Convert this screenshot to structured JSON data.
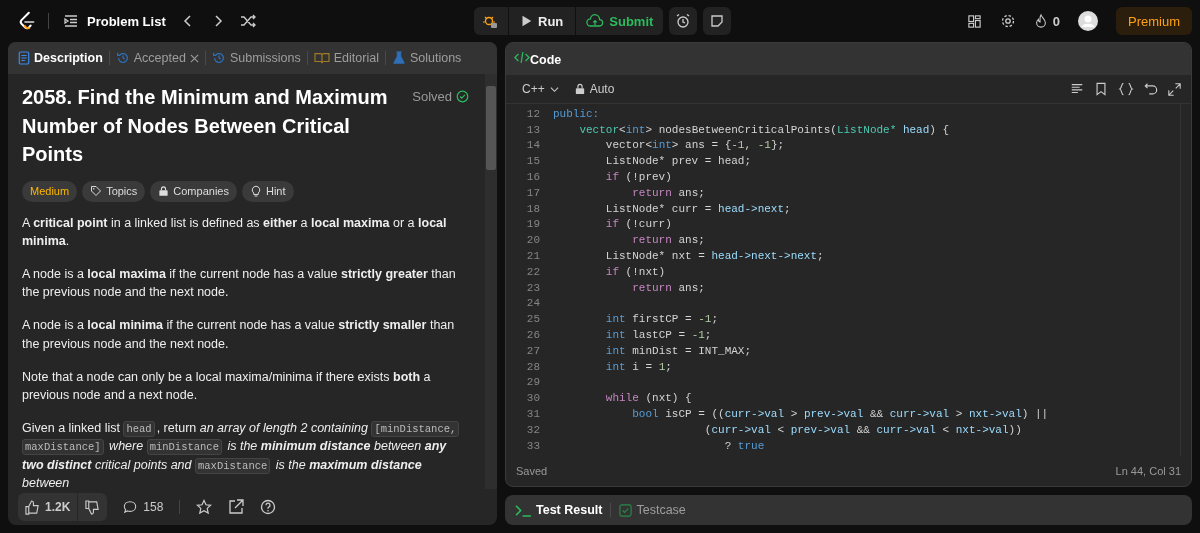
{
  "topbar": {
    "problem_list": "Problem List",
    "run": "Run",
    "submit": "Submit",
    "streak": "0",
    "premium": "Premium"
  },
  "description_panel": {
    "tabs": [
      {
        "label": "Description",
        "selected": true,
        "closable": false
      },
      {
        "label": "Accepted",
        "selected": false,
        "closable": true
      },
      {
        "label": "Submissions",
        "selected": false,
        "closable": false
      },
      {
        "label": "Editorial",
        "selected": false,
        "closable": false
      },
      {
        "label": "Solutions",
        "selected": false,
        "closable": false
      }
    ],
    "title": "2058. Find the Minimum and Maximum Number of Nodes Between Critical Points",
    "status": "Solved",
    "tags": [
      {
        "label": "Medium",
        "kind": "difficulty"
      },
      {
        "label": "Topics",
        "kind": "topics"
      },
      {
        "label": "Companies",
        "kind": "companies"
      },
      {
        "label": "Hint",
        "kind": "hint"
      }
    ],
    "paragraphs": [
      [
        {
          "kind": "text",
          "text": "A **critical point** in a linked list is defined as **either** a **local maxima** or a **local minima**."
        }
      ],
      [
        {
          "kind": "text",
          "text": "A node is a **local maxima** if the current node has a value **strictly greater** than the previous node and the next node."
        }
      ],
      [
        {
          "kind": "text",
          "text": "A node is a **local minima** if the current node has a value **strictly smaller** than the previous node and the next node."
        }
      ],
      [
        {
          "kind": "text",
          "text": "Note that a node can only be a local maxima/minima if there exists **both** a previous node and a next node."
        }
      ],
      [
        {
          "kind": "text",
          "text": "Given a linked list "
        },
        {
          "kind": "code",
          "text": "head"
        },
        {
          "kind": "text",
          "text": ", return "
        },
        {
          "kind": "italic",
          "text": "an array of length 2 containing "
        },
        {
          "kind": "code",
          "text": "[minDistance,"
        },
        {
          "kind": "code",
          "text": "maxDistance]"
        },
        {
          "kind": "italic",
          "text": " where "
        },
        {
          "kind": "code",
          "text": "minDistance"
        },
        {
          "kind": "italic",
          "text": " is the **minimum distance** between **any two distinct** critical points and "
        },
        {
          "kind": "code",
          "text": "maxDistance"
        },
        {
          "kind": "italic",
          "text": " is the **maximum distance** between"
        }
      ]
    ],
    "footer": {
      "likes": "1.2K",
      "comments": "158"
    }
  },
  "code_panel": {
    "title": "Code",
    "language": "C++",
    "mode": "Auto",
    "status": "Saved",
    "cursor": "Ln 44, Col 31",
    "lines": [
      {
        "number": "12",
        "tokens": [
          {
            "kind": "kw",
            "text": "public:"
          }
        ]
      },
      {
        "number": "13",
        "tokens": [
          {
            "kind": "type",
            "text": "    vector"
          },
          {
            "kind": "plain",
            "text": "<"
          },
          {
            "kind": "kw",
            "text": "int"
          },
          {
            "kind": "plain",
            "text": "> nodesBetweenCriticalPoints("
          },
          {
            "kind": "type",
            "text": "ListNode* "
          },
          {
            "kind": "var",
            "text": "head"
          },
          {
            "kind": "plain",
            "text": ") {"
          }
        ]
      },
      {
        "number": "14",
        "tokens": [
          {
            "kind": "plain",
            "text": "        vector<"
          },
          {
            "kind": "kw",
            "text": "int"
          },
          {
            "kind": "plain",
            "text": "> ans = {"
          },
          {
            "kind": "num",
            "text": "-1"
          },
          {
            "kind": "plain",
            "text": ", "
          },
          {
            "kind": "num",
            "text": "-1"
          },
          {
            "kind": "plain",
            "text": "};"
          }
        ]
      },
      {
        "number": "15",
        "tokens": [
          {
            "kind": "plain",
            "text": "        ListNode* prev = head;"
          }
        ]
      },
      {
        "number": "16",
        "tokens": [
          {
            "kind": "ctrl",
            "text": "        if"
          },
          {
            "kind": "plain",
            "text": " (!prev)"
          }
        ]
      },
      {
        "number": "17",
        "tokens": [
          {
            "kind": "ctrl",
            "text": "            return"
          },
          {
            "kind": "plain",
            "text": " ans;"
          }
        ]
      },
      {
        "number": "18",
        "tokens": [
          {
            "kind": "plain",
            "text": "        ListNode* curr = "
          },
          {
            "kind": "var",
            "text": "head->next"
          },
          {
            "kind": "plain",
            "text": ";"
          }
        ]
      },
      {
        "number": "19",
        "tokens": [
          {
            "kind": "ctrl",
            "text": "        if"
          },
          {
            "kind": "plain",
            "text": " (!curr)"
          }
        ]
      },
      {
        "number": "20",
        "tokens": [
          {
            "kind": "ctrl",
            "text": "            return"
          },
          {
            "kind": "plain",
            "text": " ans;"
          }
        ]
      },
      {
        "number": "21",
        "tokens": [
          {
            "kind": "plain",
            "text": "        ListNode* nxt = "
          },
          {
            "kind": "var",
            "text": "head->next->next"
          },
          {
            "kind": "plain",
            "text": ";"
          }
        ]
      },
      {
        "number": "22",
        "tokens": [
          {
            "kind": "ctrl",
            "text": "        if"
          },
          {
            "kind": "plain",
            "text": " (!nxt)"
          }
        ]
      },
      {
        "number": "23",
        "tokens": [
          {
            "kind": "ctrl",
            "text": "            return"
          },
          {
            "kind": "plain",
            "text": " ans;"
          }
        ]
      },
      {
        "number": "24"
      },
      {
        "number": "25",
        "tokens": [
          {
            "kind": "kw",
            "text": "        int"
          },
          {
            "kind": "plain",
            "text": " firstCP = "
          },
          {
            "kind": "num",
            "text": "-1"
          },
          {
            "kind": "plain",
            "text": ";"
          }
        ]
      },
      {
        "number": "26",
        "tokens": [
          {
            "kind": "kw",
            "text": "        int"
          },
          {
            "kind": "plain",
            "text": " lastCP = "
          },
          {
            "kind": "num",
            "text": "-1"
          },
          {
            "kind": "plain",
            "text": ";"
          }
        ]
      },
      {
        "number": "27",
        "tokens": [
          {
            "kind": "kw",
            "text": "        int"
          },
          {
            "kind": "plain",
            "text": " minDist = INT_MAX;"
          }
        ]
      },
      {
        "number": "28",
        "tokens": [
          {
            "kind": "kw",
            "text": "        int"
          },
          {
            "kind": "plain",
            "text": " i = "
          },
          {
            "kind": "num",
            "text": "1"
          },
          {
            "kind": "plain",
            "text": ";"
          }
        ]
      },
      {
        "number": "29"
      },
      {
        "number": "30",
        "tokens": [
          {
            "kind": "ctrl",
            "text": "        while"
          },
          {
            "kind": "plain",
            "text": " (nxt) {"
          }
        ]
      },
      {
        "number": "31",
        "tokens": [
          {
            "kind": "kw",
            "text": "            bool"
          },
          {
            "kind": "plain",
            "text": " isCP = (("
          },
          {
            "kind": "var",
            "text": "curr->val"
          },
          {
            "kind": "plain",
            "text": " > "
          },
          {
            "kind": "var",
            "text": "prev->val"
          },
          {
            "kind": "plain",
            "text": " && "
          },
          {
            "kind": "var",
            "text": "curr->val"
          },
          {
            "kind": "plain",
            "text": " > "
          },
          {
            "kind": "var",
            "text": "nxt->val"
          },
          {
            "kind": "plain",
            "text": ") ||"
          }
        ]
      },
      {
        "number": "32",
        "tokens": [
          {
            "kind": "plain",
            "text": "                       ("
          },
          {
            "kind": "var",
            "text": "curr->val"
          },
          {
            "kind": "plain",
            "text": " < "
          },
          {
            "kind": "var",
            "text": "prev->val"
          },
          {
            "kind": "plain",
            "text": " && "
          },
          {
            "kind": "var",
            "text": "curr->val"
          },
          {
            "kind": "plain",
            "text": " < "
          },
          {
            "kind": "var",
            "text": "nxt->val"
          },
          {
            "kind": "plain",
            "text": "))"
          }
        ]
      },
      {
        "number": "33",
        "tokens": [
          {
            "kind": "plain",
            "text": "                          ? "
          },
          {
            "kind": "kw",
            "text": "true"
          }
        ]
      }
    ]
  },
  "test_panel": {
    "tabs": [
      {
        "label": "Test Result",
        "selected": true
      },
      {
        "label": "Testcase",
        "selected": false
      }
    ]
  }
}
